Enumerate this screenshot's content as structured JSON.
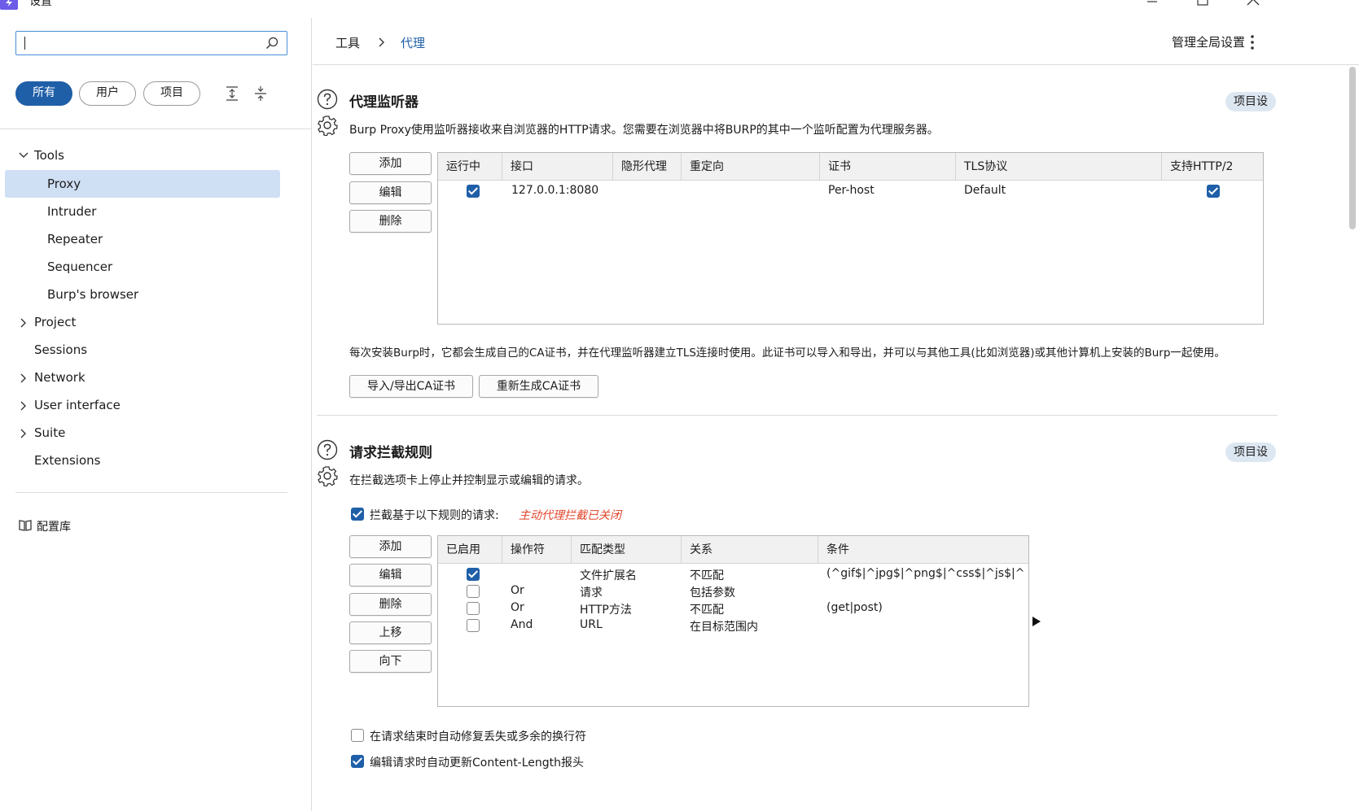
{
  "window": {
    "title": "设置"
  },
  "sidebar": {
    "search": {
      "value": "",
      "placeholder": ""
    },
    "filters": [
      "所有",
      "用户",
      "项目"
    ],
    "tree": [
      {
        "label": "Tools",
        "expanded": true
      },
      {
        "label": "Proxy",
        "selected": true
      },
      {
        "label": "Intruder"
      },
      {
        "label": "Repeater"
      },
      {
        "label": "Sequencer"
      },
      {
        "label": "Burp's browser"
      },
      {
        "label": "Project",
        "expandable": true
      },
      {
        "label": "Sessions"
      },
      {
        "label": "Network",
        "expandable": true
      },
      {
        "label": "User interface",
        "expandable": true
      },
      {
        "label": "Suite",
        "expandable": true
      },
      {
        "label": "Extensions"
      }
    ],
    "library": "配置库"
  },
  "header": {
    "breadcrumb": [
      "工具",
      "代理"
    ],
    "manage": "管理全局设置"
  },
  "listeners": {
    "title": "代理监听器",
    "description": "Burp Proxy使用监听器接收来自浏览器的HTTP请求。您需要在浏览器中将BURP的其中一个监听配置为代理服务器。",
    "project_tag": "项目设",
    "buttons": [
      "添加",
      "编辑",
      "删除"
    ],
    "columns": [
      "运行中",
      "接口",
      "隐形代理",
      "重定向",
      "证书",
      "TLS协议",
      "支持HTTP/2"
    ],
    "rows": [
      {
        "running": true,
        "interface": "127.0.0.1:8080",
        "invisible": "",
        "redirect": "",
        "cert": "Per-host",
        "tls": "Default",
        "http2": true
      }
    ],
    "ca_text": "每次安装Burp时，它都会生成自己的CA证书，并在代理监听器建立TLS连接时使用。此证书可以导入和导出，并可以与其他工具(比如浏览器)或其他计算机上安装的Burp一起使用。",
    "ca_buttons": [
      "导入/导出CA证书",
      "重新生成CA证书"
    ]
  },
  "intercept": {
    "title": "请求拦截规则",
    "description": "在拦截选项卡上停止并控制显示或编辑的请求。",
    "project_tag": "项目设",
    "enable_label": "拦截基于以下规则的请求:",
    "enable_checked": true,
    "warning": "主动代理拦截已关闭",
    "buttons": [
      "添加",
      "编辑",
      "删除",
      "上移",
      "向下"
    ],
    "columns": [
      "已启用",
      "操作符",
      "匹配类型",
      "关系",
      "条件"
    ],
    "rows": [
      {
        "enabled": true,
        "op": "",
        "match": "文件扩展名",
        "relation": "不匹配",
        "condition": "(^gif$|^jpg$|^png$|^css$|^js$|^..."
      },
      {
        "enabled": false,
        "op": "Or",
        "match": "请求",
        "relation": "包括参数",
        "condition": ""
      },
      {
        "enabled": false,
        "op": "Or",
        "match": "HTTP方法",
        "relation": "不匹配",
        "condition": "(get|post)"
      },
      {
        "enabled": false,
        "op": "And",
        "match": "URL",
        "relation": "在目标范围内",
        "condition": ""
      }
    ],
    "options": [
      {
        "label": "在请求结束时自动修复丢失或多余的换行符",
        "checked": false
      },
      {
        "label": "编辑请求时自动更新Content-Length报头",
        "checked": true
      }
    ]
  },
  "colors": {
    "accent": "#1f5fa8",
    "selected_bg": "#cfdff4",
    "warning": "#e0452b",
    "logo": "#6c5ce7"
  }
}
